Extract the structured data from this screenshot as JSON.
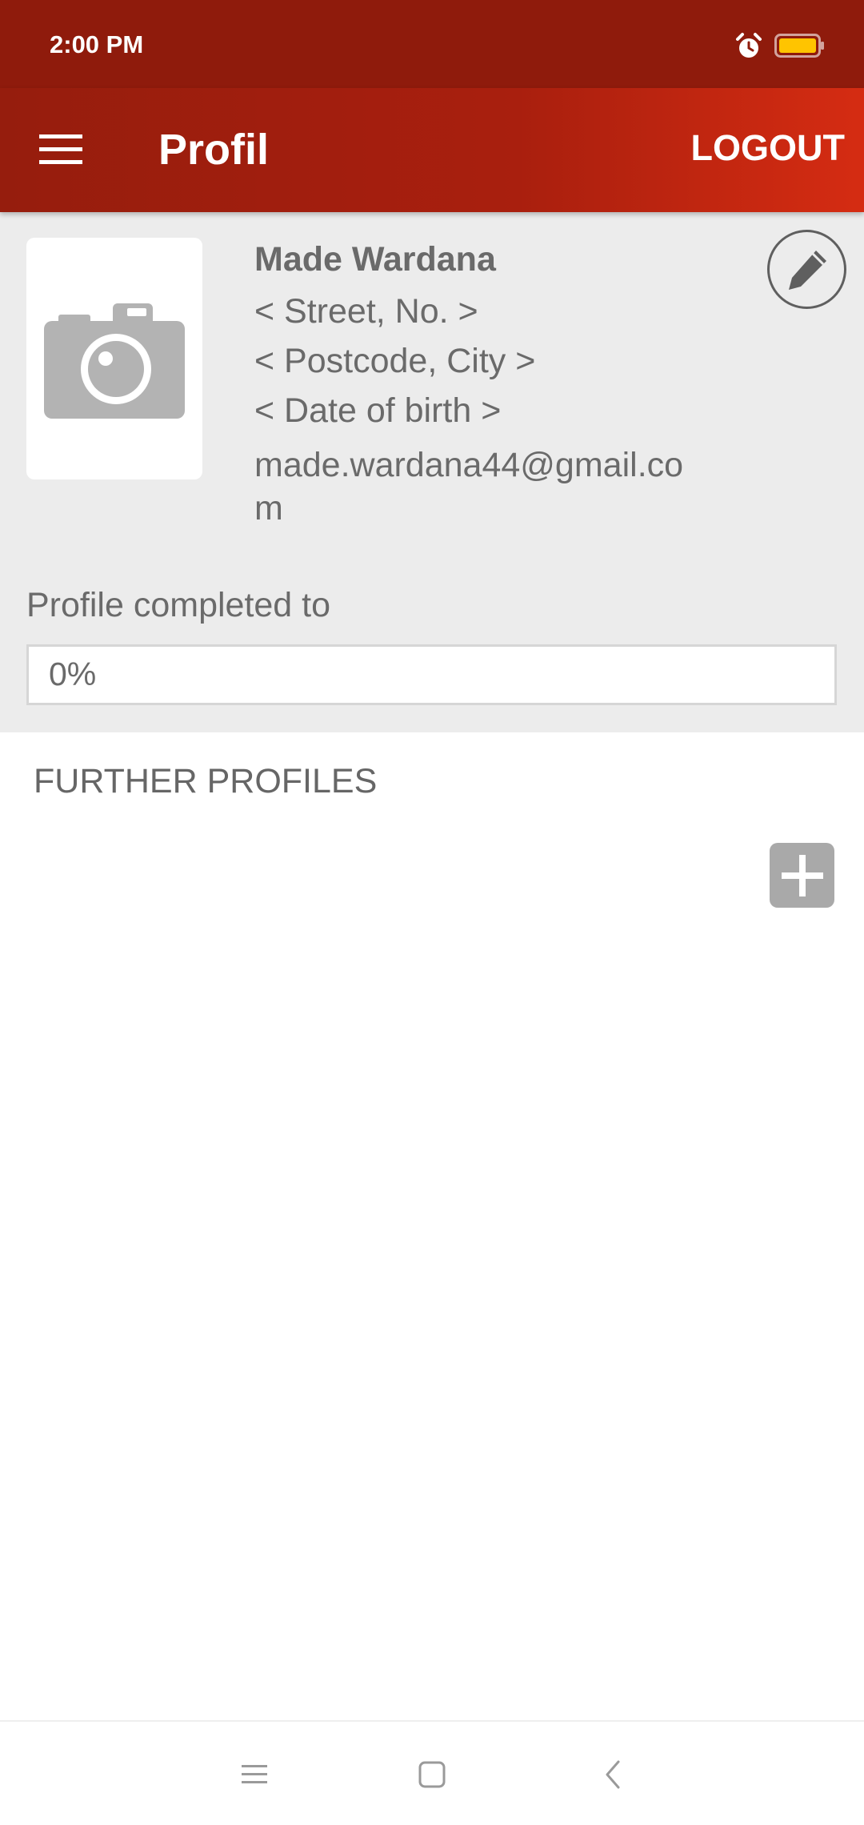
{
  "status_bar": {
    "time": "2:00 PM",
    "icons": [
      "alarm-icon",
      "battery-icon"
    ],
    "battery_color": "#ffc400"
  },
  "app_bar": {
    "menu_icon": "hamburger-menu-icon",
    "title": "Profil",
    "logout_label": "LOGOUT",
    "colors": {
      "start": "#961d0d",
      "end": "#d52c12"
    }
  },
  "profile": {
    "avatar_icon": "camera-icon",
    "name": "Made Wardana",
    "street": "< Street, No. >",
    "postcode_city": "< Postcode, City >",
    "date_of_birth": "< Date of birth >",
    "email": "made.wardana44@gmail.com",
    "edit_icon": "pencil-icon"
  },
  "completion": {
    "label": "Profile completed to",
    "value_text": "0%",
    "fraction": 0
  },
  "further_profiles": {
    "title": "FURTHER PROFILES",
    "add_icon": "plus-icon"
  },
  "nav_bar": {
    "icons": [
      "recents-icon",
      "home-icon",
      "back-icon"
    ]
  }
}
